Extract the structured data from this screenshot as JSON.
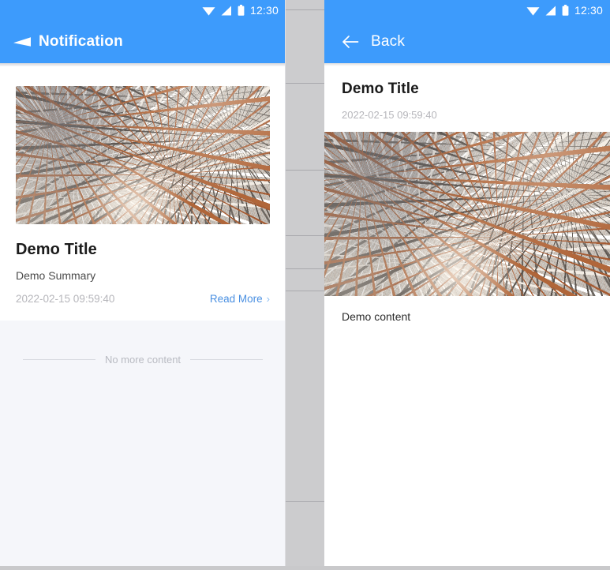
{
  "theme": {
    "accent": "#3d9bfc",
    "link": "#4a90e2",
    "page_bg": "#f5f6fa",
    "seam_gray": "#ccccce",
    "muted_text": "#b6b6bb"
  },
  "left_panel": {
    "status_bar": {
      "clock": "12:30",
      "icons": [
        "wifi-icon",
        "cellular-signal-icon",
        "battery-icon"
      ]
    },
    "app_bar": {
      "back_icon": "back-triangle-icon",
      "title": "Notification"
    },
    "card": {
      "thumbnail_alt": "granite-texture-thumbnail",
      "title": "Demo Title",
      "summary": "Demo Summary",
      "date": "2022-02-15 09:59:40",
      "read_more_label": "Read More",
      "read_more_chevron": "chevron-right-icon"
    },
    "footer": {
      "no_more_text": "No more content"
    }
  },
  "right_panel": {
    "status_bar": {
      "clock": "12:30",
      "icons": [
        "wifi-icon",
        "cellular-signal-icon",
        "battery-icon"
      ]
    },
    "app_bar": {
      "back_icon": "arrow-left-icon",
      "title": "Back"
    },
    "detail": {
      "title": "Demo Title",
      "date": "2022-02-15 09:59:40",
      "hero_alt": "granite-texture-hero",
      "body": "Demo content"
    }
  },
  "seam": {
    "divider_offsets": [
      12,
      105,
      215,
      298,
      340,
      368,
      635
    ]
  }
}
